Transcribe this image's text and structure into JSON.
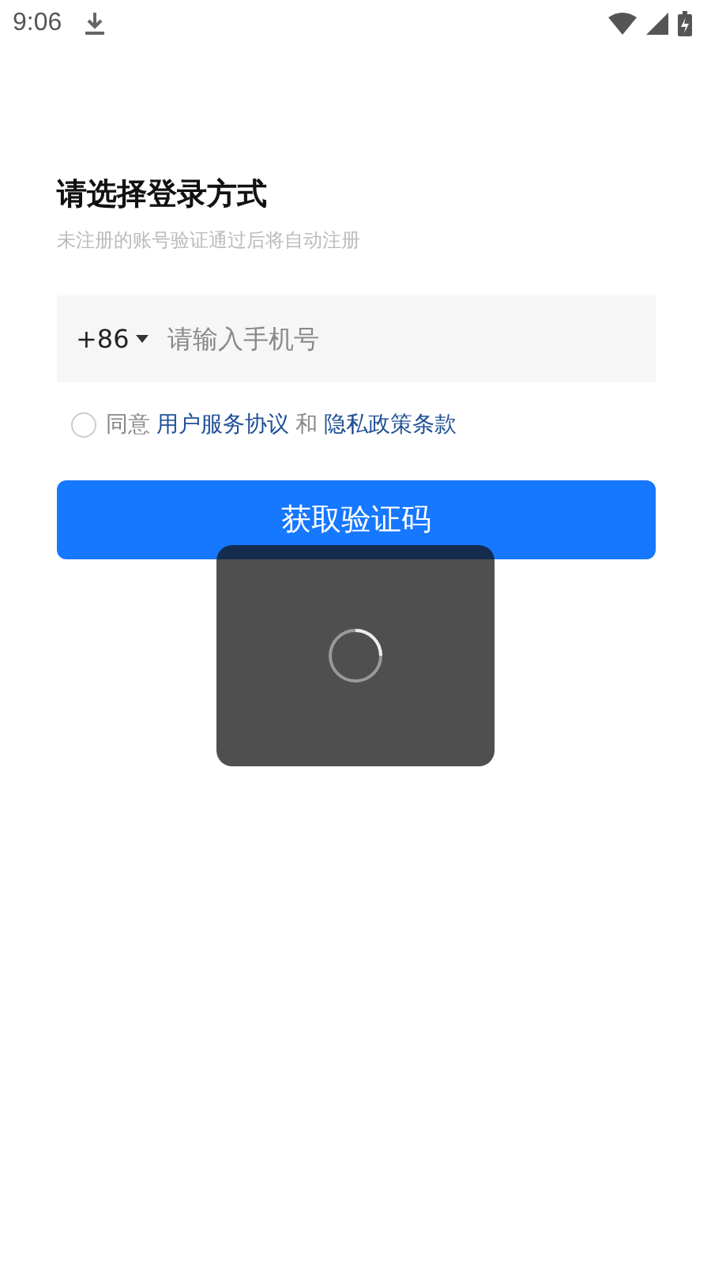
{
  "status_bar": {
    "time": "9:06"
  },
  "login": {
    "title": "请选择登录方式",
    "subtitle": "未注册的账号验证通过后将自动注册"
  },
  "phone_field": {
    "country_code": "+86",
    "placeholder": "请输入手机号"
  },
  "agreement": {
    "checked": false,
    "prefix": "同意",
    "link_1": "用户服务协议",
    "joiner": "和",
    "link_2": "隐私政策条款"
  },
  "submit_button": "获取验证码",
  "loading": {
    "shown": true
  }
}
